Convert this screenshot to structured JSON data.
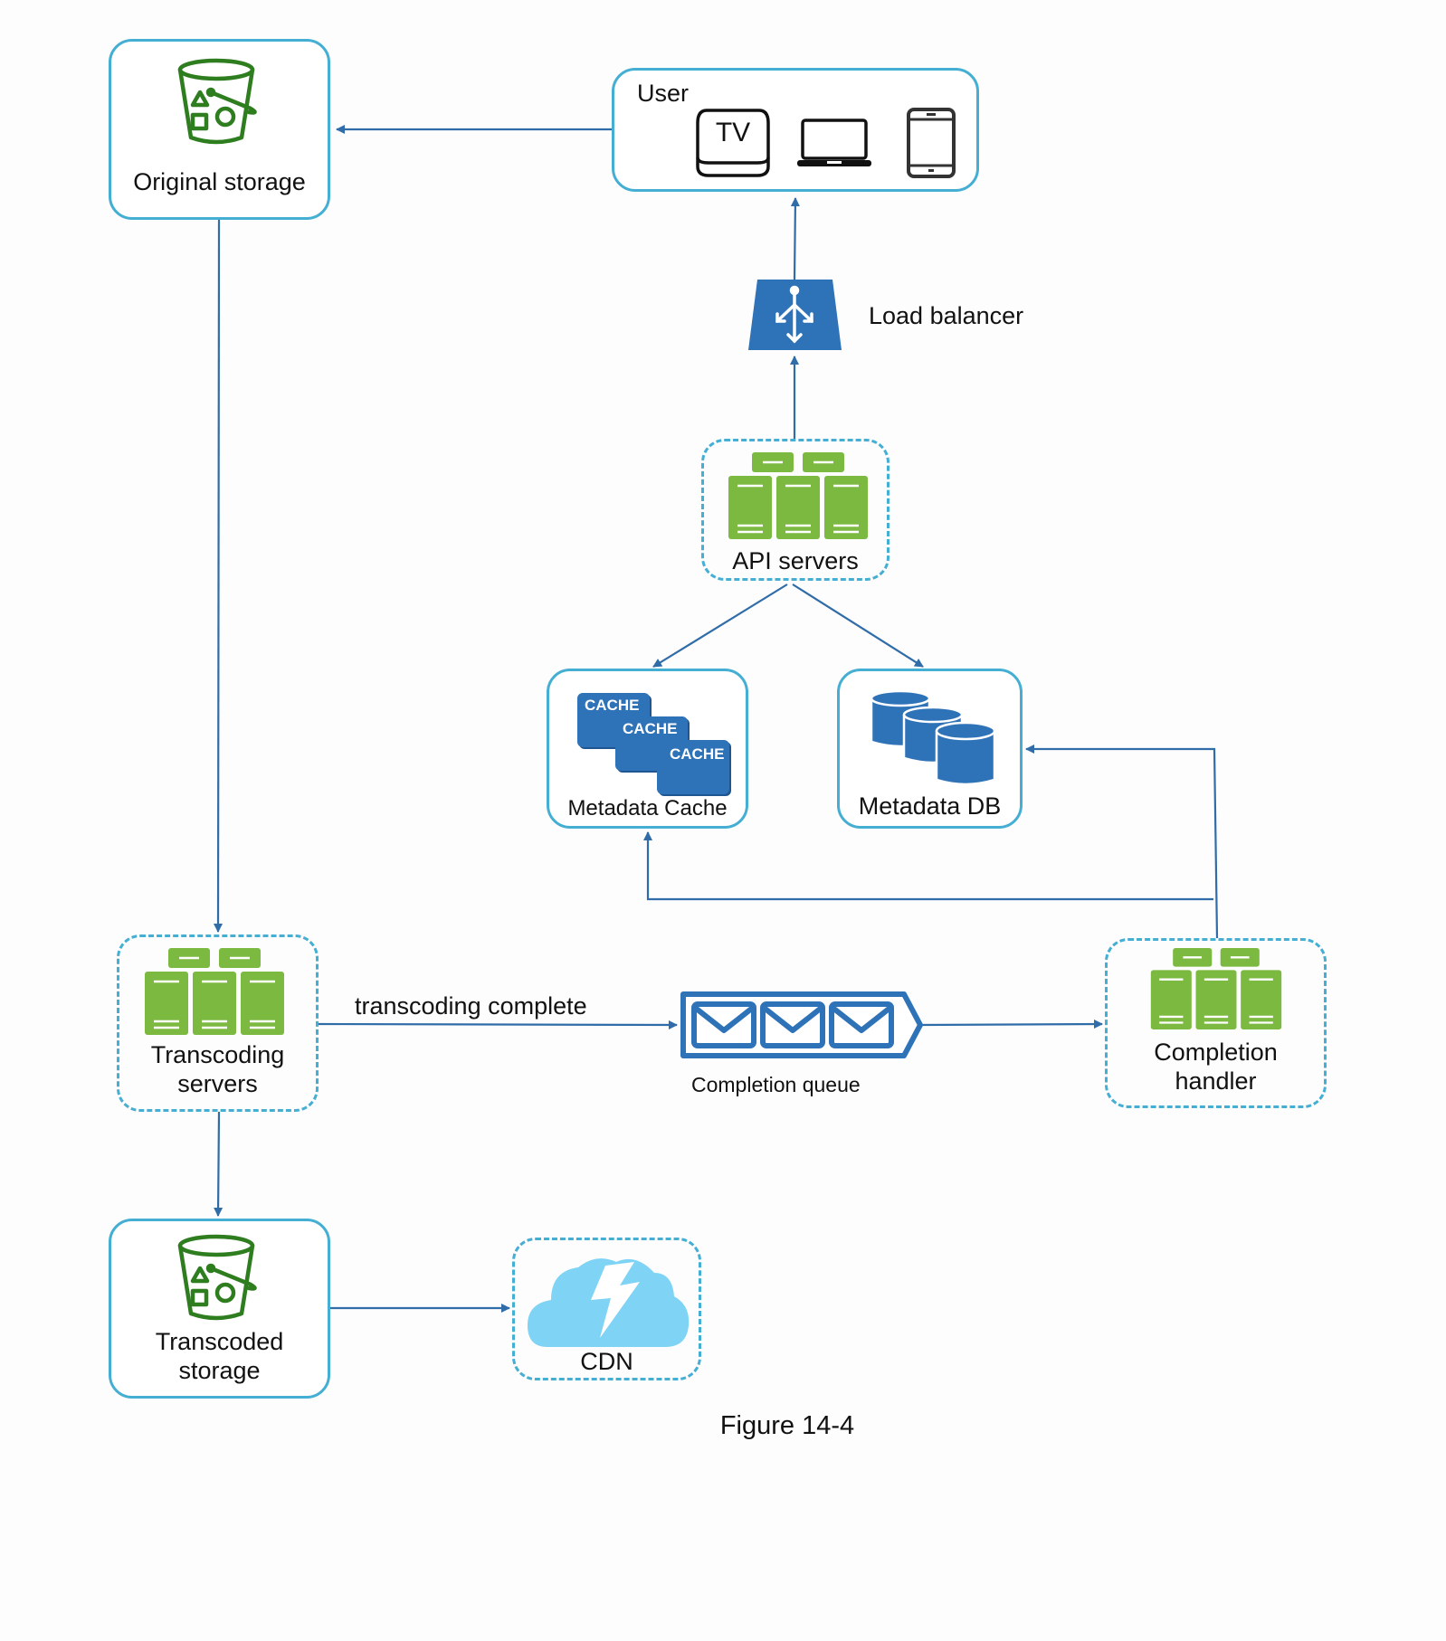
{
  "diagram": {
    "caption": "Figure 14-4",
    "colors": {
      "box_border": "#44aed3",
      "arrow": "#2f6ca8",
      "server_green": "#7cb940",
      "icon_blue": "#2e72b8",
      "bucket_green": "#2e7d1f",
      "cdn_cloud": "#7fd3f4"
    },
    "nodes": {
      "original_storage": {
        "label": "Original storage",
        "icon": "bucket-icon"
      },
      "user": {
        "label": "User",
        "devices": [
          "tv-icon",
          "laptop-icon",
          "tablet-icon"
        ],
        "tv_text": "TV"
      },
      "load_balancer": {
        "label": "Load balancer",
        "icon": "load-balancer-icon"
      },
      "api_servers": {
        "label": "API servers",
        "icon": "servers-icon"
      },
      "metadata_cache": {
        "label": "Metadata Cache",
        "icon": "cache-icon",
        "cache_texts": [
          "CACHE",
          "CACHE",
          "CACHE"
        ]
      },
      "metadata_db": {
        "label": "Metadata DB",
        "icon": "database-icon"
      },
      "transcoding_servers": {
        "label_line1": "Transcoding",
        "label_line2": "servers",
        "icon": "servers-icon"
      },
      "completion_queue": {
        "label": "Completion queue",
        "icon": "queue-icon"
      },
      "completion_handler": {
        "label_line1": "Completion",
        "label_line2": "handler",
        "icon": "servers-icon"
      },
      "transcoded_storage": {
        "label_line1": "Transcoded",
        "label_line2": "storage",
        "icon": "bucket-icon"
      },
      "cdn": {
        "label": "CDN",
        "icon": "cdn-cloud-icon"
      }
    },
    "edges": [
      {
        "from": "User",
        "to": "Original storage"
      },
      {
        "from": "Load balancer",
        "to": "User"
      },
      {
        "from": "API servers",
        "to": "Load balancer"
      },
      {
        "from": "API servers",
        "to": "Metadata Cache"
      },
      {
        "from": "API servers",
        "to": "Metadata DB"
      },
      {
        "from": "Original storage",
        "to": "Transcoding servers"
      },
      {
        "from": "Transcoding servers",
        "to": "Completion queue",
        "label": "transcoding complete"
      },
      {
        "from": "Completion queue",
        "to": "Completion handler"
      },
      {
        "from": "Completion handler",
        "to": "Metadata DB"
      },
      {
        "from": "Completion handler",
        "to": "Metadata Cache"
      },
      {
        "from": "Transcoding servers",
        "to": "Transcoded storage"
      },
      {
        "from": "Transcoded storage",
        "to": "CDN"
      }
    ],
    "edge_label_transcoding": "transcoding complete"
  }
}
